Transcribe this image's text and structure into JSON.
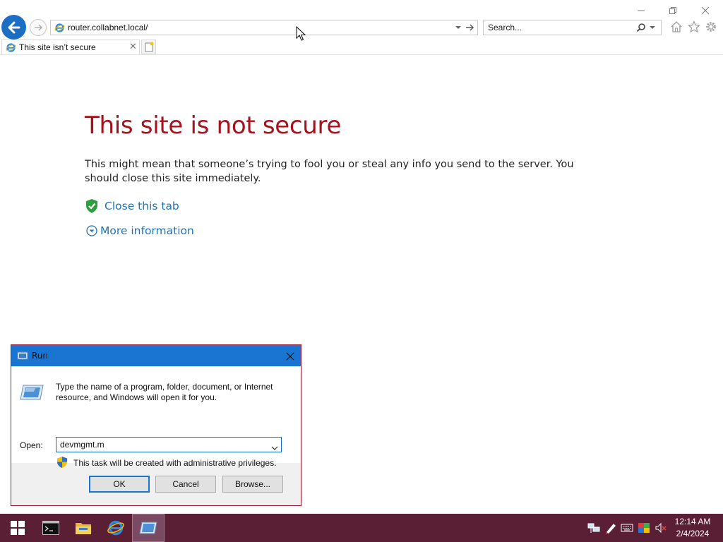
{
  "browser": {
    "address_url": "router.collabnet.local/",
    "search_placeholder": "Search...",
    "tab_title": "This site isn’t secure",
    "icons": [
      "back-icon",
      "forward-icon",
      "ie-favicon",
      "dropdown-arrow-icon",
      "go-arrow-icon",
      "search-icon",
      "home-icon",
      "favorites-star-icon",
      "settings-gear-icon",
      "new-tab-icon",
      "minimize-icon",
      "restore-icon",
      "close-icon"
    ]
  },
  "page": {
    "heading": "This site is not secure",
    "body": "This might mean that someone’s trying to fool you or steal any info you send to the server. You should close this site immediately.",
    "close_tab_link": "Close this tab",
    "more_info_link": "More information",
    "heading_color": "#a4131d",
    "link_color": "#1e73b6"
  },
  "run_dialog": {
    "title": "Run",
    "description": "Type the name of a program, folder, document, or Internet resource, and Windows will open it for you.",
    "open_label": "Open:",
    "open_value": "devmgmt.m",
    "admin_note": "This task will be created with administrative privileges.",
    "ok_label": "OK",
    "cancel_label": "Cancel",
    "browse_label": "Browse..."
  },
  "taskbar": {
    "apps": [
      "start-icon",
      "command-prompt-icon",
      "file-explorer-icon",
      "internet-explorer-icon",
      "run-icon"
    ],
    "tray_icons": [
      "network-icon",
      "pen-icon",
      "keyboard-icon",
      "color-icon",
      "volume-muted-icon"
    ],
    "time": "12:14 AM",
    "date": "2/4/2024",
    "background_color": "#5b1f35"
  }
}
